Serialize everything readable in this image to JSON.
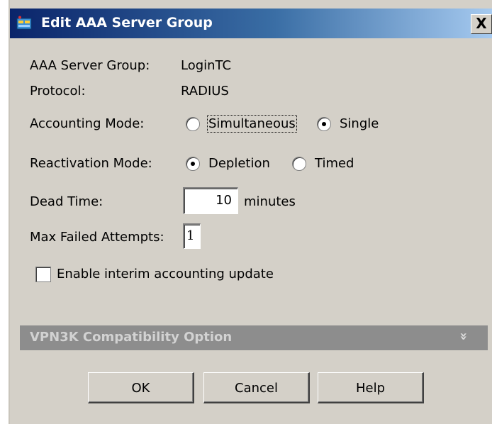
{
  "window": {
    "title": "Edit AAA Server Group",
    "close_glyph": "X",
    "icon": "server-group-icon"
  },
  "form": {
    "server_group_label": "AAA Server Group:",
    "server_group_value": "LoginTC",
    "protocol_label": "Protocol:",
    "protocol_value": "RADIUS",
    "accounting_mode_label": "Accounting Mode:",
    "accounting_options": [
      {
        "label": "Simultaneous",
        "selected": false
      },
      {
        "label": "Single",
        "selected": true
      }
    ],
    "reactivation_mode_label": "Reactivation Mode:",
    "reactivation_options": [
      {
        "label": "Depletion",
        "selected": true
      },
      {
        "label": "Timed",
        "selected": false
      }
    ],
    "dead_time_label": "Dead Time:",
    "dead_time_value": "10",
    "dead_time_unit": "minutes",
    "max_failed_label": "Max Failed Attempts:",
    "max_failed_value": "1",
    "interim_label": "Enable interim accounting update",
    "interim_checked": false
  },
  "section": {
    "title": "VPN3K Compatibility Option",
    "chevron": "»"
  },
  "buttons": {
    "ok": "OK",
    "cancel": "Cancel",
    "help": "Help"
  },
  "colors": {
    "dialog_bg": "#d4d0c8",
    "title_gradient_start": "#0a246a",
    "title_gradient_end": "#a6caf0",
    "section_bg": "#8d8d8d"
  }
}
